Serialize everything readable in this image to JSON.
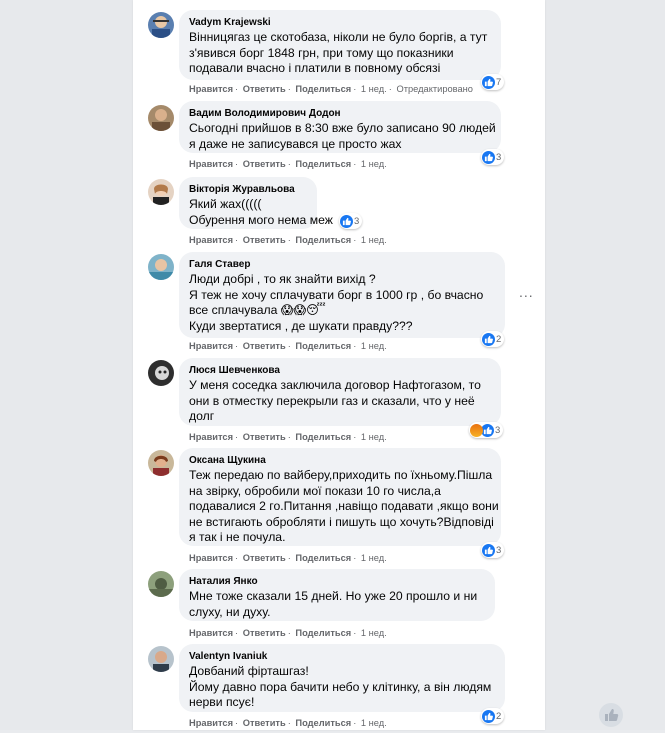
{
  "ui": {
    "more_options_label": "...",
    "colors": {
      "like_blue": "#1877f2",
      "bubble_bg": "#f0f2f5",
      "meta_gray": "#65676b"
    }
  },
  "comments": [
    {
      "author": "Vadym Krajewski",
      "lines": [
        "Вінницягаз це скотобаза, ніколи не було боргів, а тут",
        "з'явився борг 1848 грн, при тому що показники",
        "подавали вчасно і платили в повному обсязі"
      ],
      "actions": [
        "Нравится",
        "Ответить",
        "Поделиться"
      ],
      "time": "1 нед.",
      "edited": "Отредактировано",
      "reactions": {
        "icons": [
          "like-icon"
        ],
        "count": "7"
      }
    },
    {
      "author": "Вадим Володимирович Додон",
      "lines": [
        "Сьогодні прийшов в 8:30 вже було записано 90 людей",
        "я даже не записувався це просто жах"
      ],
      "actions": [
        "Нравится",
        "Ответить",
        "Поделиться"
      ],
      "time": "1 нед.",
      "reactions": {
        "icons": [
          "like-icon"
        ],
        "count": "3"
      }
    },
    {
      "author": "Вікторія Журавльова",
      "lines": [
        "Який жах(((((",
        "Обурення мого нема меж"
      ],
      "actions": [
        "Нравится",
        "Ответить",
        "Поделиться"
      ],
      "time": "1 нед.",
      "reactions": {
        "icons": [
          "like-icon"
        ],
        "count": "3"
      }
    },
    {
      "author": "Галя Ставер",
      "lines": [
        "Люди добрі , то як знайти вихід ?",
        "Я теж не хочу сплачувати борг в 1000 гр , бо вчасно",
        "все сплачувала 😱😱😴",
        "Куди звертатися , де шукати правду???"
      ],
      "actions": [
        "Нравится",
        "Ответить",
        "Поделиться"
      ],
      "time": "1 нед.",
      "reactions": {
        "icons": [
          "like-icon"
        ],
        "count": "2"
      }
    },
    {
      "author": "Люся Шевченкова",
      "lines": [
        "У меня соседка заключила договор Нафтогазом, то",
        "они в отместку перекрыли газ и сказали, что у неё",
        "долг"
      ],
      "actions": [
        "Нравится",
        "Ответить",
        "Поделиться"
      ],
      "time": "1 нед.",
      "reactions": {
        "icons": [
          "angry-icon",
          "like-icon"
        ],
        "count": "3"
      }
    },
    {
      "author": "Оксана Щукина",
      "lines": [
        "Теж передаю по вайберу,приходить по їхньому.Пішла",
        "на звірку, обробили мої покази 10 го числа,а",
        "подавалися 2 го.Питання ,навіщо подавати ,якщо вони",
        "не встигають обробляти і пишуть що хочуть?Відповіді",
        "я так і не почула."
      ],
      "actions": [
        "Нравится",
        "Ответить",
        "Поделиться"
      ],
      "time": "1 нед.",
      "reactions": {
        "icons": [
          "like-icon"
        ],
        "count": "3"
      }
    },
    {
      "author": "Наталия Янко",
      "lines": [
        "Мне тоже сказали 15 дней. Но уже 20 прошло и ни",
        "слуху, ни духу."
      ],
      "actions": [
        "Нравится",
        "Ответить",
        "Поделиться"
      ],
      "time": "1 нед."
    },
    {
      "author": "Valentyn Ivaniuk",
      "lines": [
        "Довбаний фірташгаз!",
        "Йому давно пора бачити небо у клітинку, а він людям",
        "нерви псує!"
      ],
      "actions": [
        "Нравится",
        "Ответить",
        "Поделиться"
      ],
      "time": "1 нед.",
      "reactions": {
        "icons": [
          "like-icon"
        ],
        "count": "2"
      }
    }
  ]
}
